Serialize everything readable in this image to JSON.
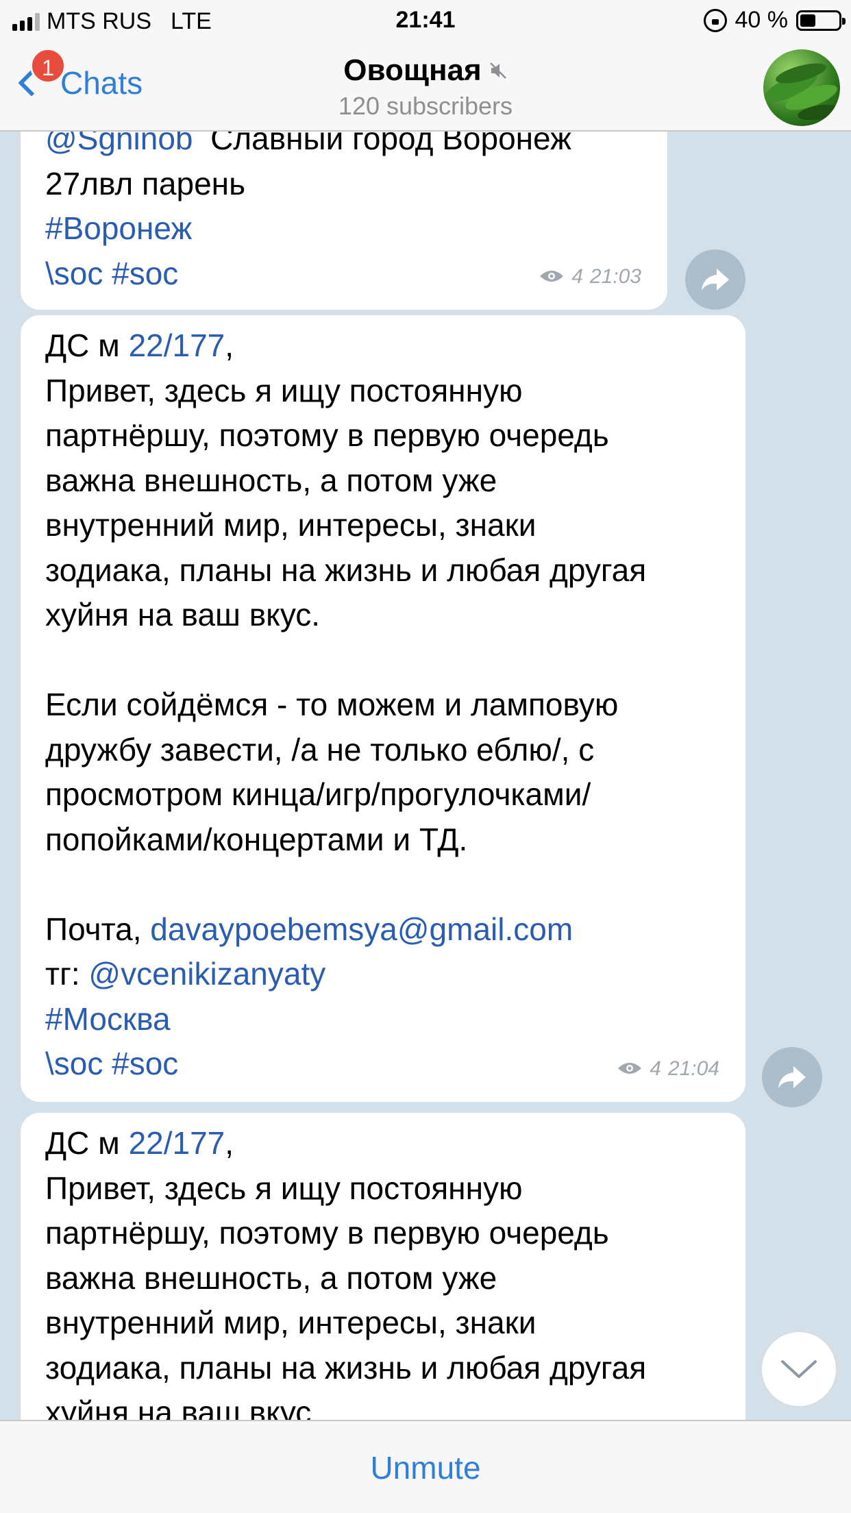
{
  "status_bar": {
    "carrier": "MTS RUS",
    "network": "LTE",
    "time": "21:41",
    "battery": "40 %",
    "battery_level_percent": 40
  },
  "nav": {
    "back_label": "Chats",
    "unread_badge": "1",
    "title": "Овощная",
    "subtitle": "120 subscribers",
    "muted": true
  },
  "messages": [
    {
      "lines": [
        [
          {
            "t": "@Sgninob",
            "link": true
          },
          {
            "t": "  Славный город Воронеж"
          }
        ],
        [
          {
            "t": "27лвл парень"
          }
        ],
        [
          {
            "t": "#Воронеж",
            "link": true
          }
        ],
        [
          {
            "t": "\\soc #soc",
            "link": true
          }
        ]
      ],
      "views": "4",
      "time": "21:03"
    },
    {
      "lines": [
        [
          {
            "t": "ДС м "
          },
          {
            "t": "22/177",
            "link": true
          },
          {
            "t": ","
          }
        ],
        [
          {
            "t": "Привет, здесь я ищу постоянную"
          }
        ],
        [
          {
            "t": "партнёршу, поэтому в первую очередь"
          }
        ],
        [
          {
            "t": "важна внешность, а потом уже"
          }
        ],
        [
          {
            "t": "внутренний мир, интересы, знаки"
          }
        ],
        [
          {
            "t": "зодиака, планы на жизнь и любая другая"
          }
        ],
        [
          {
            "t": "хуйня на ваш вкус."
          }
        ],
        [
          {
            "t": ""
          }
        ],
        [
          {
            "t": "Если сойдёмся - то можем и ламповую"
          }
        ],
        [
          {
            "t": "дружбу завести, /а не только еблю/, с"
          }
        ],
        [
          {
            "t": "просмотром кинца/игр/прогулочками/"
          }
        ],
        [
          {
            "t": "попойками/концертами и ТД."
          }
        ],
        [
          {
            "t": ""
          }
        ],
        [
          {
            "t": "Почта, "
          },
          {
            "t": "davaypoebemsya@gmail.com",
            "link": true
          }
        ],
        [
          {
            "t": "тг: "
          },
          {
            "t": "@vcenikizanyaty",
            "link": true
          }
        ],
        [
          {
            "t": "#Москва",
            "link": true
          }
        ],
        [
          {
            "t": "\\soc #soc",
            "link": true
          }
        ]
      ],
      "views": "4",
      "time": "21:04"
    },
    {
      "lines": [
        [
          {
            "t": "ДС м "
          },
          {
            "t": "22/177",
            "link": true
          },
          {
            "t": ","
          }
        ],
        [
          {
            "t": "Привет, здесь я ищу постоянную"
          }
        ],
        [
          {
            "t": "партнёршу, поэтому в первую очередь"
          }
        ],
        [
          {
            "t": "важна внешность, а потом уже"
          }
        ],
        [
          {
            "t": "внутренний мир, интересы, знаки"
          }
        ],
        [
          {
            "t": "зодиака, планы на жизнь и любая другая"
          }
        ],
        [
          {
            "t": "хуйня на ваш вкус."
          }
        ]
      ],
      "views": "",
      "time": ""
    }
  ],
  "bottom": {
    "unmute_label": "Unmute"
  },
  "colors": {
    "accent": "#2f7fd6",
    "link": "#2a5db0",
    "badge": "#e74c3c",
    "chat_background": "#d3dfe9"
  }
}
